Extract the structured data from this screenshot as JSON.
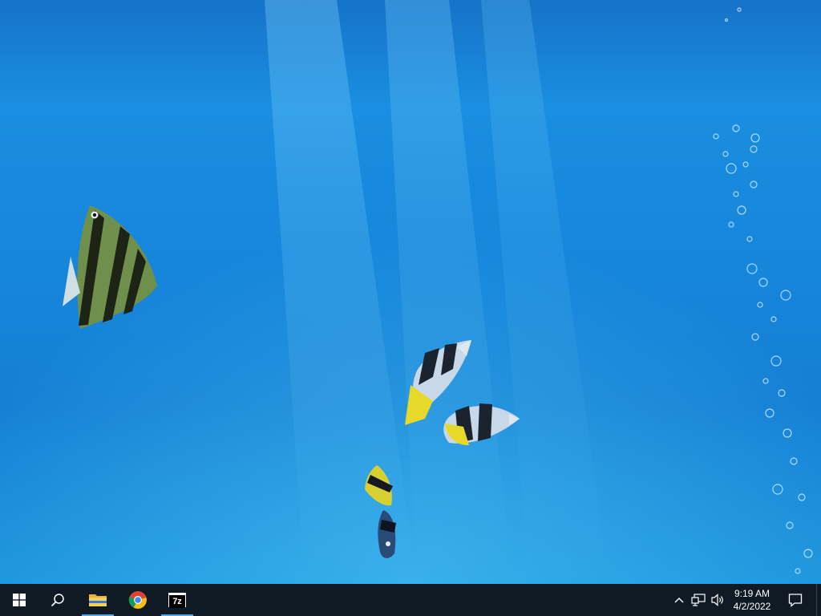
{
  "desktop": {
    "wallpaper": "underwater-aquarium",
    "colors": {
      "water_top": "#1673c9",
      "water_mid": "#1a8ee0",
      "water_bottom": "#1b93dc",
      "light_ray": "#5ec8ff"
    }
  },
  "taskbar": {
    "background": "#101a24",
    "start": {
      "icon": "windows-logo-icon"
    },
    "search": {
      "icon": "search-icon"
    },
    "apps": [
      {
        "name": "File Explorer",
        "icon": "folder-icon",
        "running": true
      },
      {
        "name": "Google Chrome",
        "icon": "chrome-icon",
        "running": false
      },
      {
        "name": "7-Zip",
        "icon": "sevenzip-icon",
        "label": "7z",
        "running": true
      }
    ],
    "tray": {
      "chevron_icon": "chevron-up-icon",
      "network_icon": "network-icon",
      "volume_icon": "volume-icon",
      "time": "9:19 AM",
      "date": "4/2/2022",
      "notification_icon": "notification-icon"
    }
  }
}
